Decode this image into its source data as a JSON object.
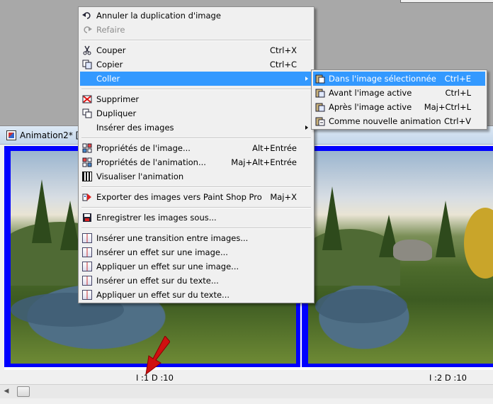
{
  "anim_window": {
    "title": "Animation2* [1"
  },
  "frames": [
    {
      "label": "I :1   D :10"
    },
    {
      "label": "I :2   D :10"
    }
  ],
  "context_menu": {
    "items": [
      {
        "label": "Annuler la duplication d'image",
        "shortcut": "",
        "icon": "undo-icon",
        "disabled": false
      },
      {
        "label": "Refaire",
        "shortcut": "",
        "icon": "redo-icon",
        "disabled": true
      },
      {
        "label": "Couper",
        "shortcut": "Ctrl+X",
        "icon": "scissors-icon",
        "disabled": false
      },
      {
        "label": "Copier",
        "shortcut": "Ctrl+C",
        "icon": "copy-icon",
        "disabled": false
      },
      {
        "label": "Coller",
        "shortcut": "",
        "icon": "",
        "disabled": false,
        "submenu": true
      },
      {
        "label": "Supprimer",
        "shortcut": "",
        "icon": "delete-icon",
        "disabled": false
      },
      {
        "label": "Dupliquer",
        "shortcut": "",
        "icon": "duplicate-icon",
        "disabled": false
      },
      {
        "label": "Insérer des images",
        "shortcut": "",
        "icon": "",
        "disabled": false,
        "submenu": true
      },
      {
        "label": "Propriétés de l'image...",
        "shortcut": "Alt+Entrée",
        "icon": "image-properties-icon",
        "disabled": false
      },
      {
        "label": "Propriétés de l'animation...",
        "shortcut": "Maj+Alt+Entrée",
        "icon": "animation-properties-icon",
        "disabled": false
      },
      {
        "label": "Visualiser l'animation",
        "shortcut": "",
        "icon": "film-icon",
        "disabled": false
      },
      {
        "label": "Exporter des images vers Paint Shop Pro",
        "shortcut": "Maj+X",
        "icon": "export-icon",
        "disabled": false
      },
      {
        "label": "Enregistrer les images sous...",
        "shortcut": "",
        "icon": "save-frames-icon",
        "disabled": false
      },
      {
        "label": "Insérer une transition entre images...",
        "shortcut": "",
        "icon": "transition-icon",
        "disabled": false
      },
      {
        "label": "Insérer un effet sur une image...",
        "shortcut": "",
        "icon": "insert-effect-icon",
        "disabled": false
      },
      {
        "label": "Appliquer un effet sur une image...",
        "shortcut": "",
        "icon": "apply-effect-icon",
        "disabled": false
      },
      {
        "label": "Insérer un effet sur du texte...",
        "shortcut": "",
        "icon": "insert-text-effect-icon",
        "disabled": false
      },
      {
        "label": "Appliquer un effet sur du texte...",
        "shortcut": "",
        "icon": "apply-text-effect-icon",
        "disabled": false
      }
    ]
  },
  "paste_submenu": {
    "items": [
      {
        "label": "Dans l'image sélectionnée",
        "shortcut": "Ctrl+E",
        "icon": "paste-into-icon"
      },
      {
        "label": "Avant l'image active",
        "shortcut": "Ctrl+L",
        "icon": "paste-before-icon"
      },
      {
        "label": "Après l'image active",
        "shortcut": "Maj+Ctrl+L",
        "icon": "paste-after-icon"
      },
      {
        "label": "Comme nouvelle animation",
        "shortcut": "Ctrl+V",
        "icon": "paste-new-icon"
      }
    ]
  },
  "colors": {
    "menu_highlight": "#3399ff",
    "frame_border": "#0000ff",
    "arrow": "#d01010"
  }
}
